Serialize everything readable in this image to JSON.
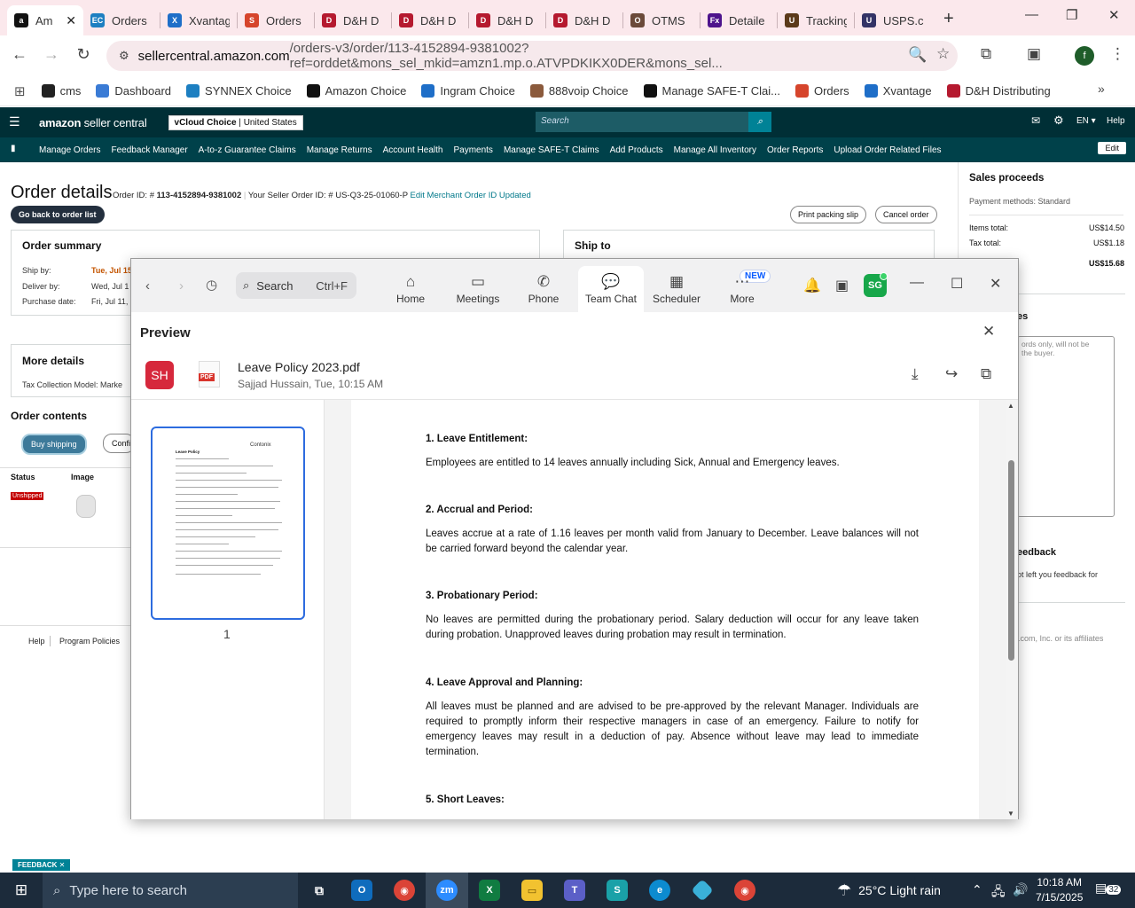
{
  "browser": {
    "tabs": [
      {
        "label": "Am",
        "icon": "amazon-icon",
        "color": "#111111",
        "glyph": "a",
        "active": true
      },
      {
        "label": "Orders",
        "icon": "synnex-icon",
        "color": "#1d7fc1",
        "glyph": "EC"
      },
      {
        "label": "Xvantag",
        "icon": "xvantage-icon",
        "color": "#1e6ec8",
        "glyph": "X"
      },
      {
        "label": "Orders",
        "icon": "swirl-icon",
        "color": "#d6452c",
        "glyph": "S"
      },
      {
        "label": "D&H D",
        "icon": "dh-icon",
        "color": "#b5192f",
        "glyph": "D&H"
      },
      {
        "label": "D&H D",
        "icon": "dh-icon",
        "color": "#b5192f",
        "glyph": "D&H"
      },
      {
        "label": "D&H D",
        "icon": "dh-icon",
        "color": "#b5192f",
        "glyph": "D&H"
      },
      {
        "label": "D&H D",
        "icon": "dh-icon",
        "color": "#b5192f",
        "glyph": "D&H"
      },
      {
        "label": "OTMS",
        "icon": "otms-icon",
        "color": "#6b4a3a",
        "glyph": "O"
      },
      {
        "label": "Detaile",
        "icon": "fedex-icon",
        "color": "#4d148c",
        "glyph": "Fx"
      },
      {
        "label": "Tracking",
        "icon": "ups-icon",
        "color": "#5b3a1a",
        "glyph": "UPS"
      },
      {
        "label": "USPS.cc",
        "icon": "usps-icon",
        "color": "#333366",
        "glyph": "U"
      }
    ],
    "url_host": "sellercentral.amazon.com",
    "url_rest": "/orders-v3/order/113-4152894-9381002?ref=orddet&mons_sel_mkid=amzn1.mp.o.ATVPDKIKX0DER&mons_sel...",
    "bookmarks": [
      {
        "label": "cms",
        "icon": "cms-icon",
        "color": "#222222"
      },
      {
        "label": "Dashboard",
        "icon": "dashboard-icon",
        "color": "#3a7bd5"
      },
      {
        "label": "SYNNEX Choice",
        "icon": "synnex-icon",
        "color": "#1d7fc1"
      },
      {
        "label": "Amazon Choice",
        "icon": "amazon-icon",
        "color": "#111111"
      },
      {
        "label": "Ingram Choice",
        "icon": "ingram-icon",
        "color": "#1e6ec8"
      },
      {
        "label": "888voip Choice",
        "icon": "voip-icon",
        "color": "#8b5a3c"
      },
      {
        "label": "Manage SAFE-T Clai...",
        "icon": "amazon-icon",
        "color": "#111111"
      },
      {
        "label": "Orders",
        "icon": "swirl-icon",
        "color": "#d6452c"
      },
      {
        "label": "Xvantage",
        "icon": "xvantage-icon",
        "color": "#1e6ec8"
      },
      {
        "label": "D&H Distributing",
        "icon": "dh-icon",
        "color": "#b5192f"
      }
    ]
  },
  "seller": {
    "logo_bold": "amazon",
    "logo_rest": " seller central",
    "store_name": "vCloud Choice",
    "store_region": "United States",
    "search_placeholder": "Search",
    "lang": "EN",
    "help": "Help",
    "nav": [
      "Manage Orders",
      "Feedback Manager",
      "A-to-z Guarantee Claims",
      "Manage Returns",
      "Account Health",
      "Payments",
      "Manage SAFE-T Claims",
      "Add Products",
      "Manage All Inventory",
      "Order Reports",
      "Upload Order Related Files"
    ],
    "edit": "Edit",
    "title": "Order details",
    "order_id_label": "Order ID: # ",
    "order_id": "113-4152894-9381002",
    "seller_order_label": "Your Seller Order ID: # US-Q3-25-01060-P",
    "edit_merchant": "Edit Merchant Order ID",
    "updated": "Updated",
    "back_btn": "Go back to order list",
    "print_btn": "Print packing slip",
    "cancel_btn": "Cancel order",
    "summary": {
      "title": "Order summary",
      "ship_by_label": "Ship by:",
      "ship_by": "Tue, Jul 15",
      "deliver_by_label": "Deliver by:",
      "deliver_by": "Wed, Jul 1",
      "purchase_label": "Purchase date:",
      "purchase": "Fri, Jul 11,"
    },
    "ship_to": "Ship to",
    "more_details": "More details",
    "tax_model": "Tax Collection Model: Marke",
    "order_contents": "Order contents",
    "buy_shipping": "Buy shipping",
    "confirm": "Confi",
    "col_status": "Status",
    "col_image": "Image",
    "status_badge": "Unshipped",
    "footer_help": "Help",
    "footer_policies": "Program Policies",
    "copyright": ".com, Inc. or its affiliates",
    "proceeds": {
      "title": "Sales proceeds",
      "payment": "Payment methods: Standard",
      "items_label": "Items total:",
      "items": "US$14.50",
      "tax_label": "Tax total:",
      "tax": "US$1.18",
      "total": "US$15.68",
      "notes_head": "es",
      "notes_hint": "ords only, will not be\nthe buyer.",
      "feedback_head": "eedback",
      "feedback_text": "ot left you feedback for"
    },
    "feedback_tab": "FEEDBACK"
  },
  "zoom": {
    "search_label": "Search",
    "search_shortcut": "Ctrl+F",
    "tabs": [
      {
        "label": "Home",
        "icon": "home-icon",
        "glyph": "⌂"
      },
      {
        "label": "Meetings",
        "icon": "video-camera-icon",
        "glyph": "▭"
      },
      {
        "label": "Phone",
        "icon": "phone-icon",
        "glyph": "✆"
      },
      {
        "label": "Team Chat",
        "icon": "chat-bubble-icon",
        "glyph": "💬"
      },
      {
        "label": "Scheduler",
        "icon": "calendar-icon",
        "glyph": "▦"
      },
      {
        "label": "More",
        "icon": "more-dots-icon",
        "glyph": "⋯"
      }
    ],
    "new_badge": "NEW",
    "avatar": "SG",
    "preview_title": "Preview",
    "sender_avatar": "SH",
    "file_badge": "PDF",
    "file_name": "Leave Policy 2023.pdf",
    "sender_line": "Sajjad Hussain, Tue, 10:15 AM",
    "page_num": "1",
    "thumb_logo": "Contonix",
    "thumb_title": "Leave Policy",
    "doc": [
      {
        "h": "1. Leave Entitlement:",
        "p": "Employees are entitled to 14 leaves annually including Sick, Annual and Emergency leaves."
      },
      {
        "h": "2. Accrual and Period:",
        "p": "Leaves accrue at a rate of 1.16 leaves per month valid from January to December. Leave balances will not be carried forward beyond the calendar year."
      },
      {
        "h": "3. Probationary Period:",
        "p": "No leaves are permitted during the probationary period. Salary deduction will occur for any leave taken during probation. Unapproved leaves during probation may result in termination."
      },
      {
        "h": "4. Leave Approval and Planning:",
        "p": "All leaves must be planned and are advised to be pre-approved by the relevant Manager. Individuals are required to promptly inform their respective managers in case of an emergency. Failure to notify for emergency leaves may result in a deduction of pay. Absence without leave may lead to immediate termination."
      },
      {
        "h": "5. Short Leaves:",
        "p": ""
      }
    ]
  },
  "taskbar": {
    "search_placeholder": "Type here to search",
    "weather_temp": "25°C",
    "weather_desc": "Light rain",
    "time": "10:18 AM",
    "date": "7/15/2025",
    "notif_count": "32"
  }
}
